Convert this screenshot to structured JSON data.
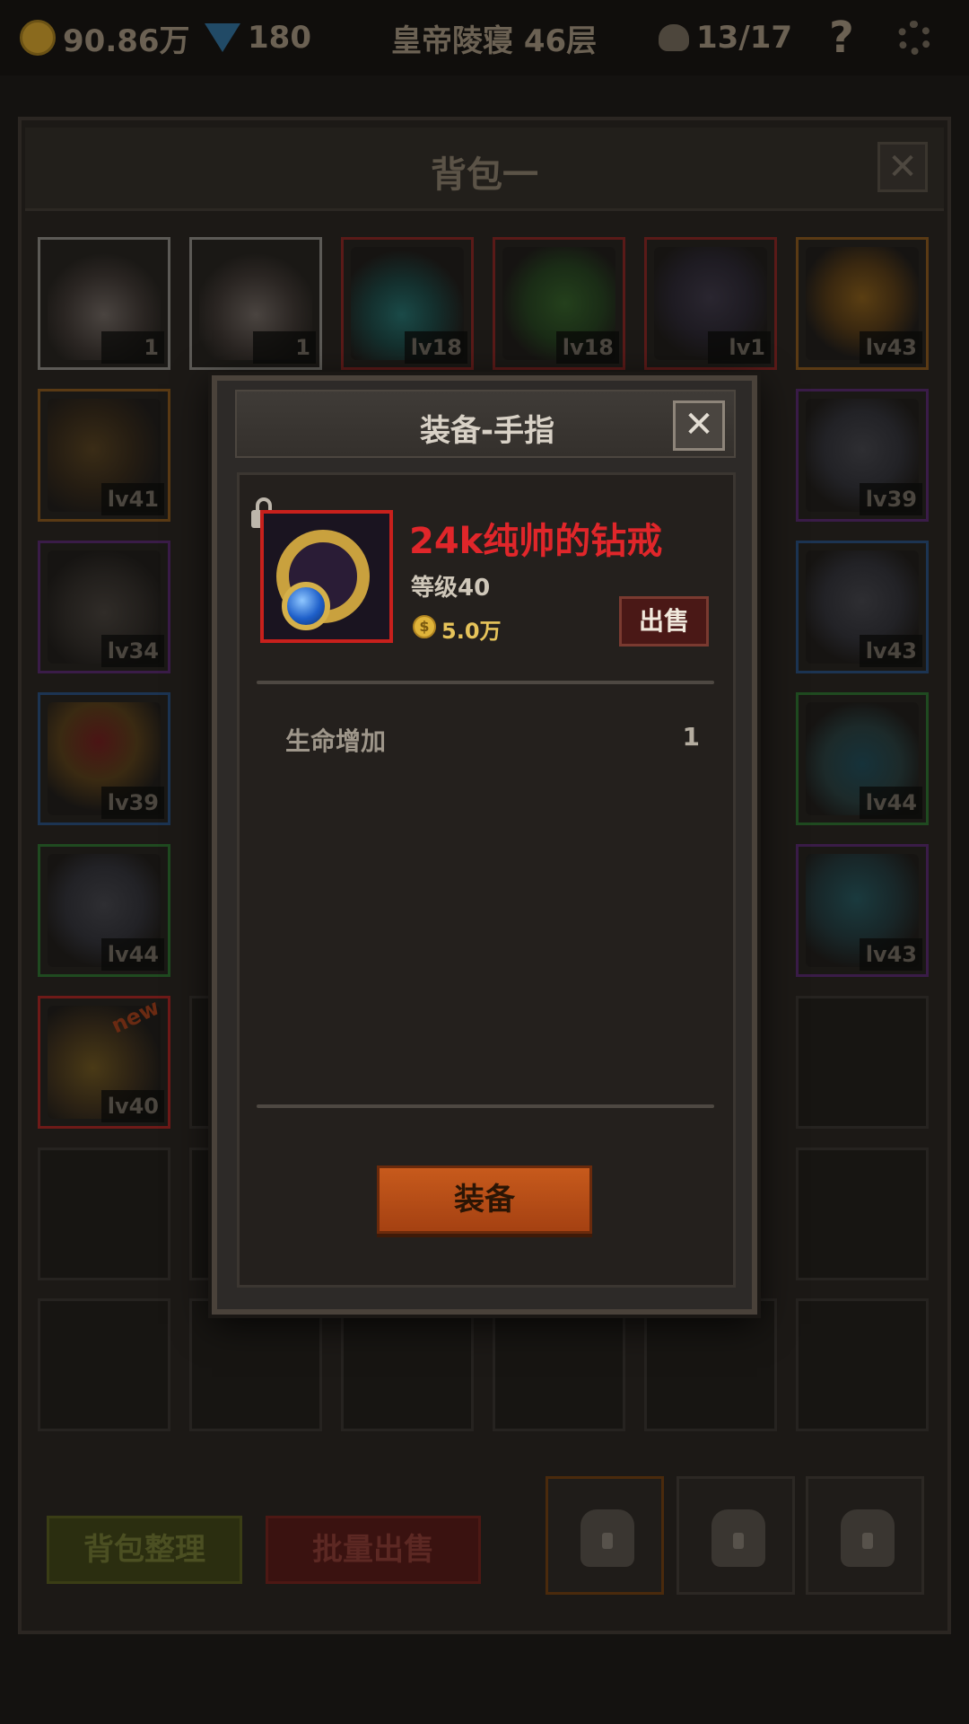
{
  "hud": {
    "gold": "90.86万",
    "gems": "180",
    "location": "皇帝陵寝 46层",
    "kills": "13/17",
    "help": "?"
  },
  "bag": {
    "title": "背包一",
    "close": "✕",
    "sort_label": "背包整理",
    "batch_sell_label": "批量出售",
    "slots": [
      {
        "level": "1",
        "icon": "cake-icon"
      },
      {
        "level": "1",
        "icon": "cake-icon"
      },
      {
        "level": "lv18",
        "icon": "amulet-icon"
      },
      {
        "level": "lv18",
        "icon": "cloak-icon"
      },
      {
        "level": "lv1",
        "icon": "chest-armor-icon"
      },
      {
        "level": "lv43",
        "icon": "ring-icon"
      },
      {
        "level": "lv41",
        "icon": "bow-icon"
      },
      {
        "level": "lv39",
        "icon": "helmet-icon"
      },
      {
        "level": "lv34",
        "icon": "shoulder-armor-icon"
      },
      {
        "level": "lv43",
        "icon": "helmet-icon"
      },
      {
        "level": "lv39",
        "icon": "ruby-ring-icon"
      },
      {
        "level": "lv44",
        "icon": "boots-icon"
      },
      {
        "level": "lv44",
        "icon": "helmet-icon"
      },
      {
        "level": "lv43",
        "icon": "staff-icon"
      },
      {
        "level": "lv40",
        "icon": "ring-icon",
        "badge": "new"
      }
    ]
  },
  "dialog": {
    "title": "装备-手指",
    "close": "✕",
    "item_name": "24k纯帅的钻戒",
    "item_level": "等级40",
    "price": "5.0万",
    "sell_label": "出售",
    "stats": [
      {
        "name": "生命增加",
        "value": "1"
      }
    ],
    "equip_label": "装备"
  },
  "colors": {
    "item_name": "#e0262a",
    "rarity_border": "#c8201c",
    "equip_button": "#c75a1c"
  }
}
